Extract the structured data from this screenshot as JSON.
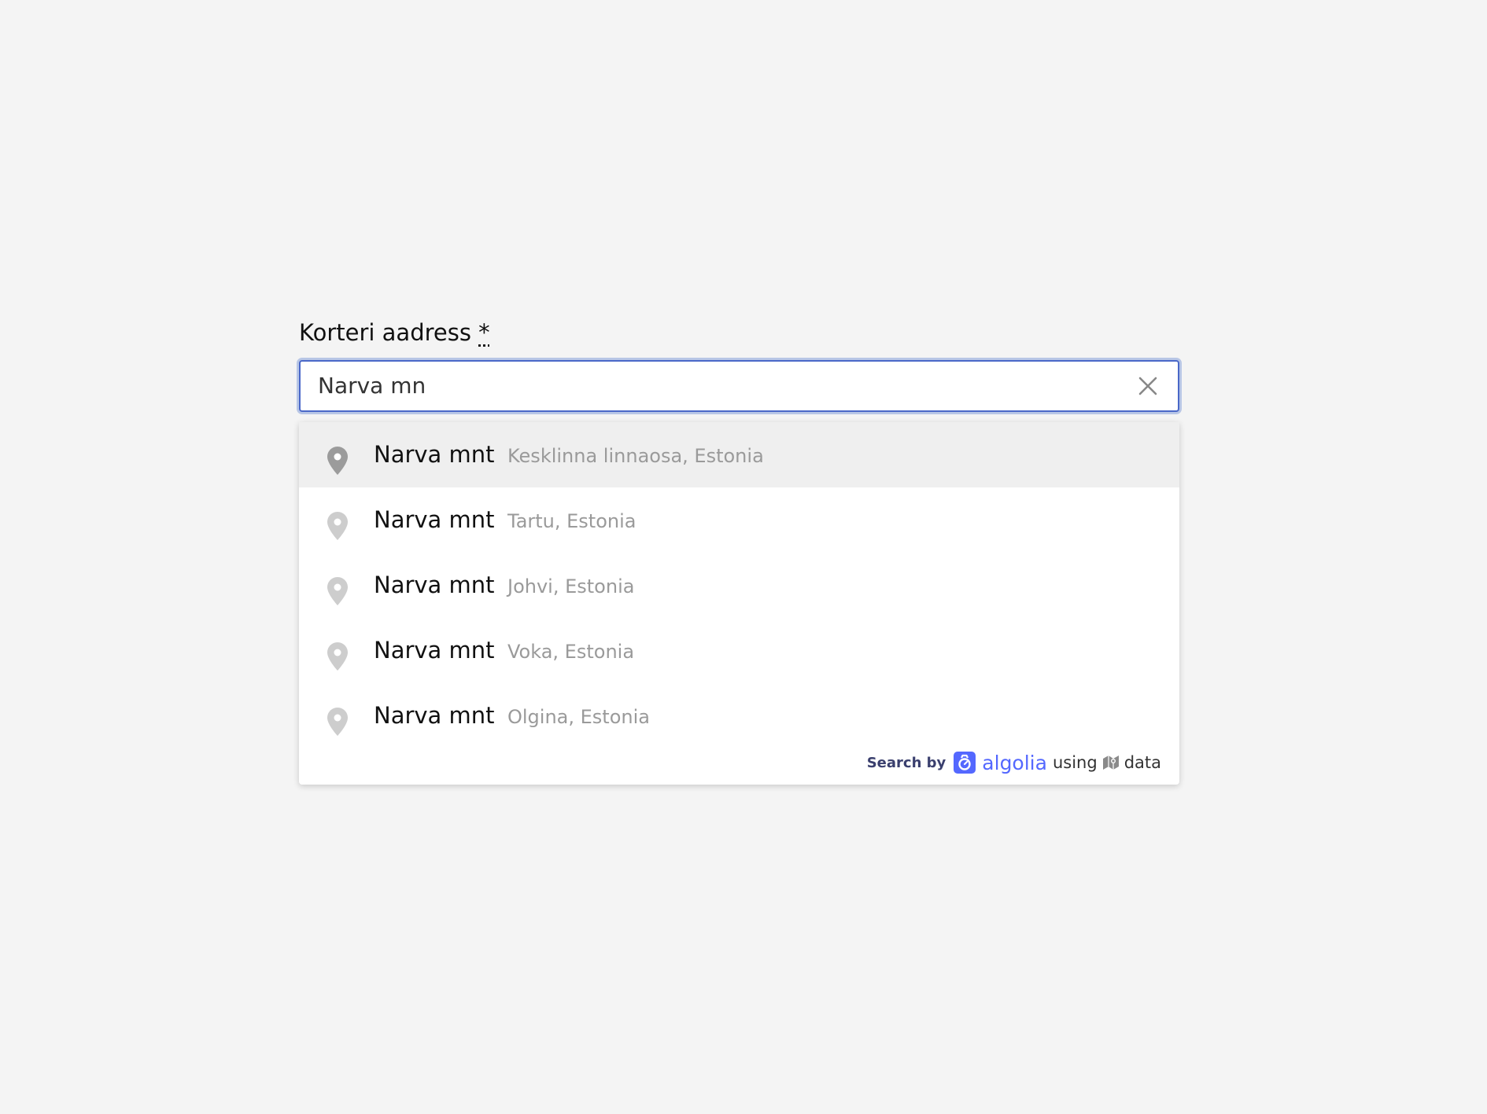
{
  "field": {
    "label": "Korteri aadress",
    "required_mark": "*",
    "input_value": "Narva mn",
    "clear_icon": "close-icon"
  },
  "suggestions": [
    {
      "name": "Narva mnt",
      "region": "Kesklinna linnaosa, Estonia",
      "icon": "map-pin-icon",
      "active": true
    },
    {
      "name": "Narva mnt",
      "region": "Tartu, Estonia",
      "icon": "map-pin-icon",
      "active": false
    },
    {
      "name": "Narva mnt",
      "region": "Johvi, Estonia",
      "icon": "map-pin-icon",
      "active": false
    },
    {
      "name": "Narva mnt",
      "region": "Voka, Estonia",
      "icon": "map-pin-icon",
      "active": false
    },
    {
      "name": "Narva mnt",
      "region": "Olgina, Estonia",
      "icon": "map-pin-icon",
      "active": false
    }
  ],
  "footer": {
    "prefix": "Search by",
    "brand": "algolia",
    "using": "using",
    "data": "data",
    "brand_icon": "algolia-logo-icon",
    "data_icon": "openstreetmap-icon"
  },
  "colors": {
    "accent": "#4a68c8",
    "brand": "#5468ff",
    "active_row": "#efefef",
    "active_pin": "#9b9b9b",
    "inactive_pin": "#cdcdcd"
  }
}
